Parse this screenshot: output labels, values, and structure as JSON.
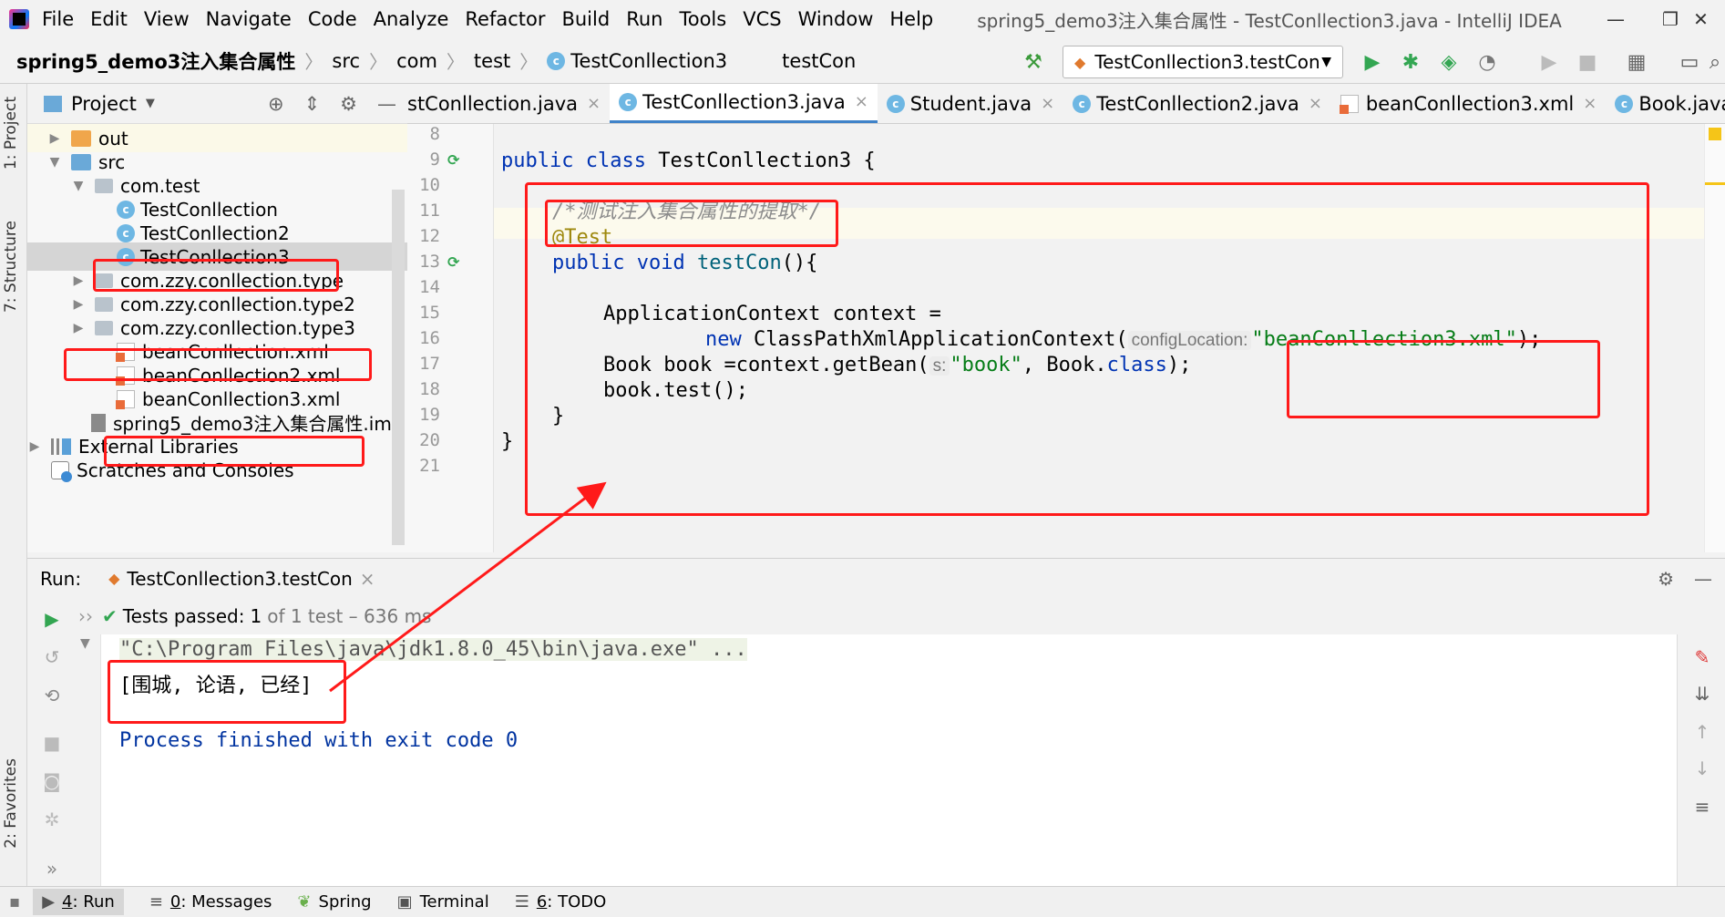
{
  "app": {
    "window_title": "spring5_demo3注入集合属性 - TestConllection3.java - IntelliJ IDEA",
    "menu": [
      "File",
      "Edit",
      "View",
      "Navigate",
      "Code",
      "Analyze",
      "Refactor",
      "Build",
      "Run",
      "Tools",
      "VCS",
      "Window",
      "Help"
    ],
    "window_controls": {
      "minimize": "—",
      "restore": "❐",
      "close": "✕"
    }
  },
  "breadcrumb": {
    "project": "spring5_demo3注入集合属性",
    "items": [
      "src",
      "com",
      "test",
      "TestConllection3",
      "testCon"
    ]
  },
  "toolbar": {
    "run_config": "TestConllection3.testCon",
    "icons": [
      "hammer-icon",
      "run-icon",
      "debug-icon",
      "coverage-icon",
      "profile-icon",
      "resume-icon",
      "stop-icon",
      "project-structure-icon",
      "terminal-icon",
      "search-icon"
    ]
  },
  "project_panel": {
    "title": "Project",
    "tree": [
      {
        "label": "out",
        "icon": "folder-orange",
        "arrow": "▶"
      },
      {
        "label": "src",
        "icon": "folder-blue",
        "arrow": "▼"
      },
      {
        "label": "com.test",
        "icon": "package",
        "arrow": "▼"
      },
      {
        "label": "TestConllection",
        "icon": "class"
      },
      {
        "label": "TestConllection2",
        "icon": "class"
      },
      {
        "label": "TestConllection3",
        "icon": "class",
        "selected": true
      },
      {
        "label": "com.zzy.conllection.type",
        "icon": "package",
        "arrow": "▶"
      },
      {
        "label": "com.zzy.conllection.type2",
        "icon": "package",
        "arrow": "▶"
      },
      {
        "label": "com.zzy.conllection.type3",
        "icon": "package",
        "arrow": "▶"
      },
      {
        "label": "beanConllection.xml",
        "icon": "xml"
      },
      {
        "label": "beanConllection2.xml",
        "icon": "xml"
      },
      {
        "label": "beanConllection3.xml",
        "icon": "xml"
      },
      {
        "label": "spring5_demo3注入集合属性.iml",
        "icon": "iml"
      },
      {
        "label": "External Libraries",
        "icon": "libs",
        "arrow": "▶"
      },
      {
        "label": "Scratches and Consoles",
        "icon": "scratch"
      }
    ]
  },
  "editor_tabs": [
    {
      "label": "stConllection.java",
      "close": "×"
    },
    {
      "label": "TestConllection3.java",
      "close": "×",
      "active": true
    },
    {
      "label": "Student.java",
      "close": "×"
    },
    {
      "label": "TestConllection2.java",
      "close": "×"
    },
    {
      "label": "beanConllection3.xml",
      "close": "×"
    },
    {
      "label": "Book.java",
      "close": "×"
    }
  ],
  "code": {
    "line_numbers": [
      "8",
      "9",
      "10",
      "11",
      "12",
      "13",
      "14",
      "15",
      "16",
      "17",
      "18",
      "19",
      "20",
      "21"
    ],
    "l9_kw1": "public",
    "l9_kw2": "class",
    "l9_rest": " TestConllection3 {",
    "l11_comment": "/*测试注入集合属性的提取*/",
    "l12_ann": "@Test",
    "l13_kw1": "public",
    "l13_kw2": "void",
    "l13_fn": "testCon",
    "l13_rest": "(){",
    "l15": "ApplicationContext context =",
    "l16_kw": "new",
    "l16_cls": " ClassPathXmlApplicationContext(",
    "l16_hint": "configLocation:",
    "l16_str": "\"beanConllection3.xml\"",
    "l16_end": ");",
    "l17_a": "Book book =context.getBean(",
    "l17_hint": "s:",
    "l17_str": "\"book\"",
    "l17_b": ", Book.",
    "l17_kw": "class",
    "l17_c": ");",
    "l18": "book.test();",
    "l19": "}",
    "l20": "}"
  },
  "run_panel": {
    "label": "Run:",
    "tab": "TestConllection3.testCon",
    "tab_close": "×",
    "chevrons": "››",
    "tests_passed_label": "Tests passed:",
    "tests_passed_count": "1",
    "tests_passed_detail": "of 1 test – 636 ms",
    "console": [
      "\"C:\\Program Files\\java\\jdk1.8.0_45\\bin\\java.exe\" ...",
      "[围城, 论语, 已经]",
      "",
      "Process finished with exit code 0"
    ]
  },
  "bottom_tabs": [
    {
      "num": "4",
      "label": ": Run",
      "icon": "run-icon",
      "active": true
    },
    {
      "num": "0",
      "label": ": Messages",
      "icon": "messages-icon"
    },
    {
      "num": "",
      "label": "Spring",
      "icon": "spring-icon"
    },
    {
      "num": "",
      "label": "Terminal",
      "icon": "terminal-icon"
    },
    {
      "num": "6",
      "label": ": TODO",
      "icon": "todo-icon"
    }
  ],
  "side_tabs": {
    "project": "1: Project",
    "structure": "7: Structure",
    "favorites": "2: Favorites"
  },
  "colors": {
    "annotation_red": "#ff1a1a",
    "run_green": "#33a652",
    "tab_active": "#4083c9"
  }
}
